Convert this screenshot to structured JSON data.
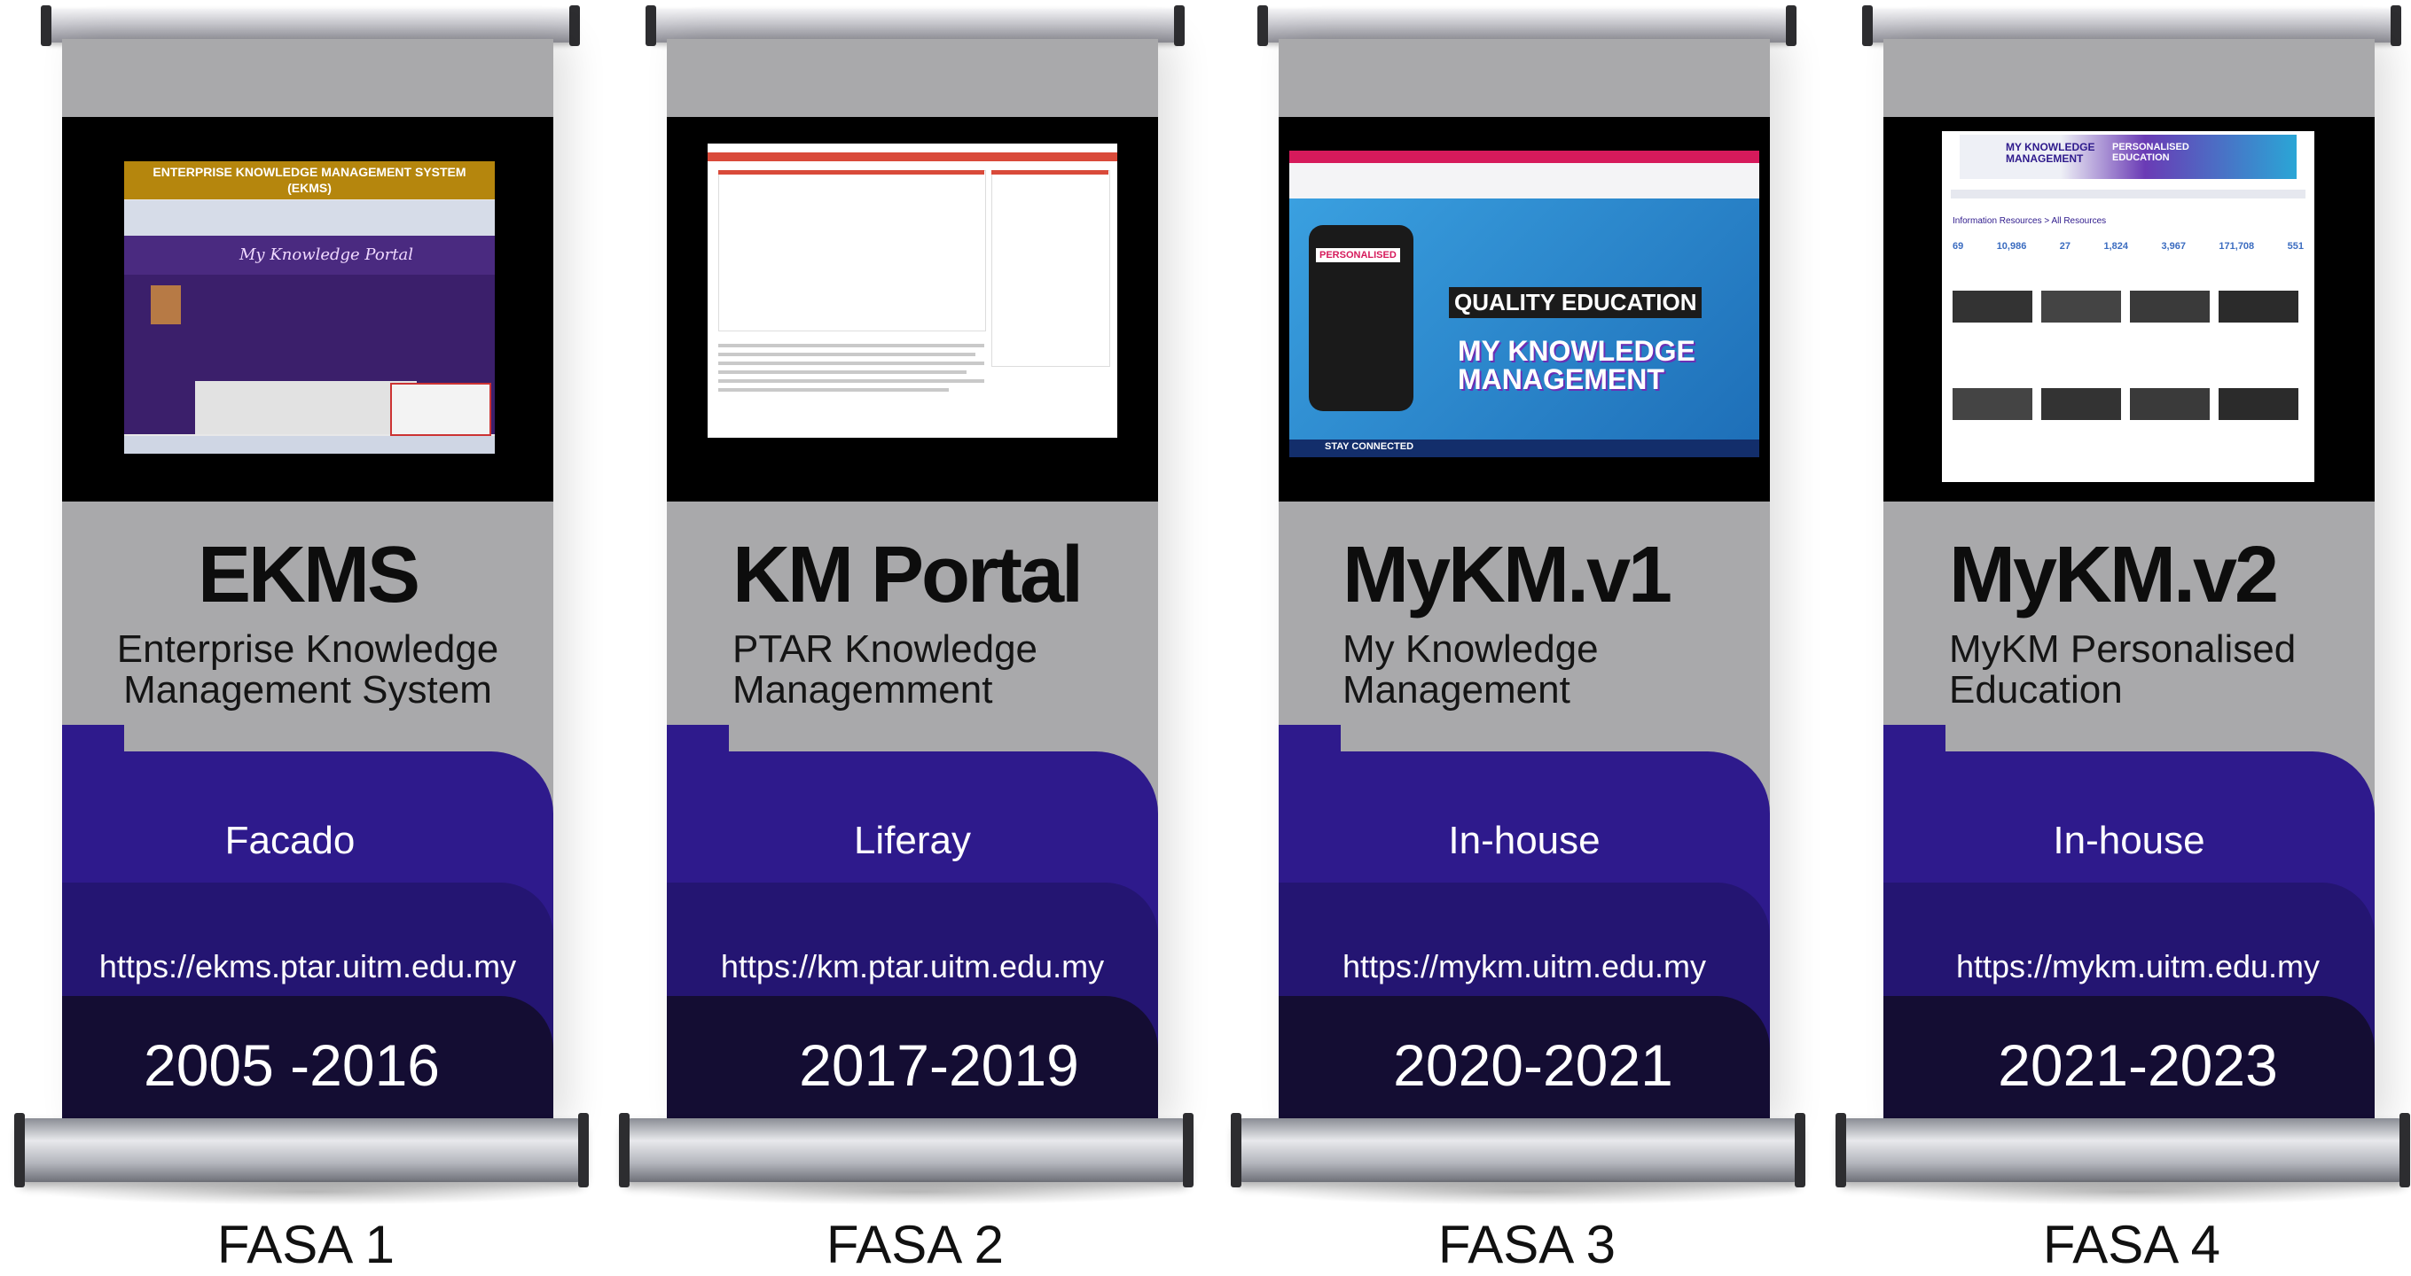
{
  "banners": [
    {
      "title": "EKMS",
      "subtitle_line1": "Enterprise Knowledge",
      "subtitle_line2": "Management System",
      "platform": "Facado",
      "url": "https://ekms.ptar.uitm.edu.my",
      "years": "2005 -2016",
      "phase": "FASA 1",
      "screenshot": {
        "header": "ENTERPRISE KNOWLEDGE MANAGEMENT SYSTEM",
        "header_sub": "(EKMS)",
        "portal_name": "My Knowledge Portal"
      }
    },
    {
      "title": "KM Portal",
      "subtitle_line1": "PTAR Knowledge",
      "subtitle_line2": "Managemment",
      "platform": "Liferay",
      "url": "https://km.ptar.uitm.edu.my",
      "years": "2017-2019",
      "phase": "FASA 2",
      "screenshot": {}
    },
    {
      "title": "MyKM.v1",
      "subtitle_line1": "My Knowledge",
      "subtitle_line2": "Management",
      "platform": "In-house",
      "url": "https://mykm.uitm.edu.my",
      "years": "2020-2021",
      "phase": "FASA 3",
      "screenshot": {
        "tag": "PERSONALISED",
        "quality": "QUALITY EDUCATION",
        "brand_line1": "MY KNOWLEDGE",
        "brand_line2": "MANAGEMENT",
        "footer": "STAY CONNECTED"
      }
    },
    {
      "title": "MyKM.v2",
      "subtitle_line1": "MyKM Personalised",
      "subtitle_line2": "Education",
      "platform": "In-house",
      "url": "https://mykm.uitm.edu.my",
      "years": "2021-2023",
      "phase": "FASA 4",
      "screenshot": {
        "brand_line1": "MY KNOWLEDGE",
        "brand_line2": "MANAGEMENT",
        "brand_tag1": "PERSONALISED",
        "brand_tag2": "EDUCATION",
        "breadcrumb": "Information Resources > All Resources",
        "stats": [
          "69",
          "10,986",
          "27",
          "1,824",
          "3,967",
          "171,708",
          "551"
        ]
      }
    }
  ],
  "colors": {
    "sheet_gray": "#a9a9ab",
    "band_1": "#2e1a8c",
    "band_2": "#241572",
    "band_3": "#140d33"
  }
}
